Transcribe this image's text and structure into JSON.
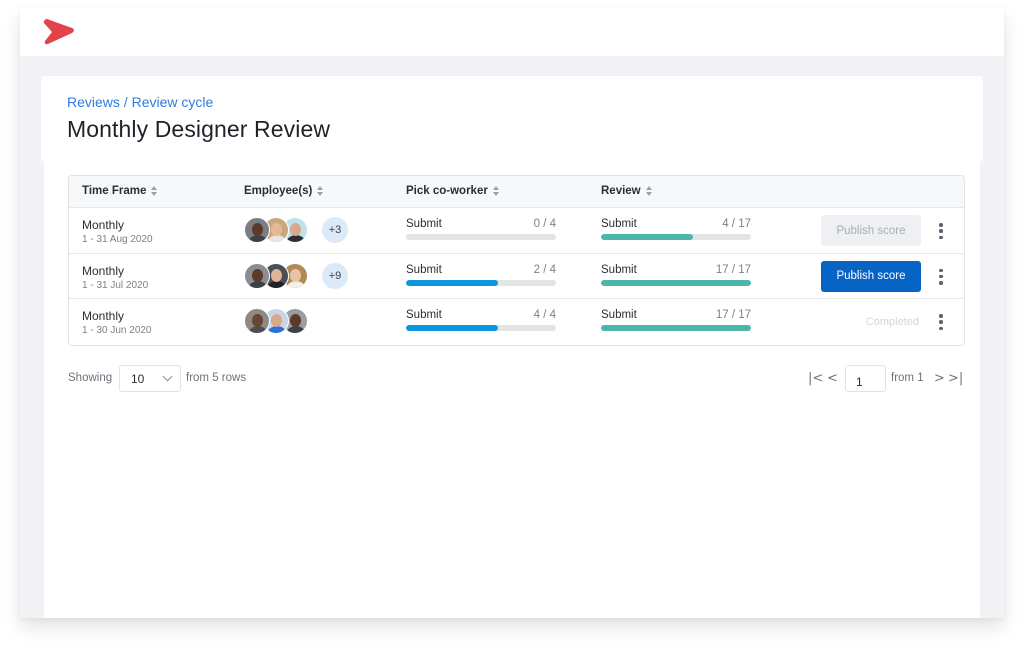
{
  "app": {
    "brand_color": "#e3424b",
    "logo_icon": "red-chevron-logo"
  },
  "header": {
    "breadcrumb": [
      "Reviews",
      "Review cycle"
    ],
    "breadcrumb_separator": " / ",
    "title": "Monthly Designer Review"
  },
  "table": {
    "columns": [
      "Time Frame",
      "Employee(s)",
      "Pick co-worker",
      "Review"
    ],
    "rows": [
      {
        "time_frame": "Monthly",
        "date_range": "1 - 31 Aug 2020",
        "avatars": [
          {
            "bg": "#7a7f86",
            "face": "#5b3a29",
            "body": "#3c4047"
          },
          {
            "bg": "#c9a77f",
            "face": "#e8b89a",
            "body": "#e9e6e1"
          },
          {
            "bg": "#bfe3ea",
            "face": "#d8a98a",
            "body": "#2b2f36"
          }
        ],
        "extra_count": "+3",
        "pick_coworker": {
          "label": "Submit",
          "value": "0 / 4",
          "progress": 0
        },
        "review": {
          "label": "Submit",
          "value": "4 / 17",
          "progress": 0.61
        },
        "action": {
          "type": "disabled",
          "label": "Publish score"
        }
      },
      {
        "time_frame": "Monthly",
        "date_range": "1 - 31 Jul 2020",
        "avatars": [
          {
            "bg": "#8a8e94",
            "face": "#5b3a29",
            "body": "#3c4047"
          },
          {
            "bg": "#4a4f57",
            "face": "#e0b497",
            "body": "#1f2228"
          },
          {
            "bg": "#b08a55",
            "face": "#ecc2a4",
            "body": "#f2efe9"
          }
        ],
        "extra_count": "+9",
        "pick_coworker": {
          "label": "Submit",
          "value": "2 / 4",
          "progress": 0.61
        },
        "review": {
          "label": "Submit",
          "value": "17 / 17",
          "progress": 1
        },
        "action": {
          "type": "primary",
          "label": "Publish score"
        }
      },
      {
        "time_frame": "Monthly",
        "date_range": "1 - 30 Jun 2020",
        "avatars": [
          {
            "bg": "#8e8a82",
            "face": "#6a4530",
            "body": "#4a4d52"
          },
          {
            "bg": "#c8d6e6",
            "face": "#d9a98b",
            "body": "#2c6fd6"
          },
          {
            "bg": "#9a9ea3",
            "face": "#5b3a29",
            "body": "#3c4047"
          }
        ],
        "extra_count": null,
        "pick_coworker": {
          "label": "Submit",
          "value": "4 / 4",
          "progress": 0.61
        },
        "review": {
          "label": "Submit",
          "value": "17 / 17",
          "progress": 1
        },
        "action": {
          "type": "status",
          "label": "Completed"
        }
      }
    ]
  },
  "footer": {
    "showing_label": "Showing",
    "page_size": "10",
    "rows_label": "from 5 rows",
    "current_page": "1",
    "pages_label": "from 1",
    "first_icon": "|<",
    "prev_icon": "<",
    "next_icon": ">",
    "last_icon": ">|"
  },
  "colors": {
    "pick_fill": "#0b96e0",
    "review_fill": "#4db6a9",
    "primary_button": "#0764c5",
    "link": "#2f7ae5"
  }
}
